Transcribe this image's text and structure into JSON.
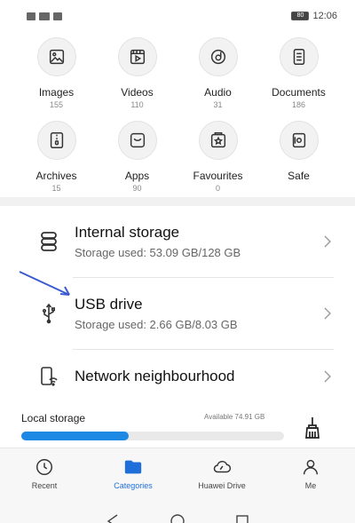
{
  "status_bar": {
    "time": "12:06",
    "battery": "80"
  },
  "categories": [
    {
      "label": "Images",
      "count": "155",
      "icon": "image-icon"
    },
    {
      "label": "Videos",
      "count": "110",
      "icon": "video-icon"
    },
    {
      "label": "Audio",
      "count": "31",
      "icon": "audio-icon"
    },
    {
      "label": "Documents",
      "count": "186",
      "icon": "document-icon"
    },
    {
      "label": "Archives",
      "count": "15",
      "icon": "archive-icon"
    },
    {
      "label": "Apps",
      "count": "90",
      "icon": "apps-icon"
    },
    {
      "label": "Favourites",
      "count": "0",
      "icon": "favourites-icon"
    },
    {
      "label": "Safe",
      "count": "",
      "icon": "safe-icon"
    }
  ],
  "storage": {
    "internal": {
      "title": "Internal storage",
      "subtitle": "Storage used: 53.09 GB/128 GB"
    },
    "usb": {
      "title": "USB drive",
      "subtitle": "Storage used: 2.66 GB/8.03 GB"
    },
    "network": {
      "title": "Network neighbourhood"
    }
  },
  "local_storage": {
    "title": "Local storage",
    "available": "Available 74.91 GB",
    "used_fraction": 0.41
  },
  "bottom_nav": [
    {
      "label": "Recent",
      "icon": "clock-icon"
    },
    {
      "label": "Categories",
      "icon": "folder-icon"
    },
    {
      "label": "Huawei Drive",
      "icon": "cloud-icon"
    },
    {
      "label": "Me",
      "icon": "person-icon"
    }
  ],
  "colors": {
    "accent": "#1e88e5",
    "annotation_arrow": "#3a5bd0"
  }
}
